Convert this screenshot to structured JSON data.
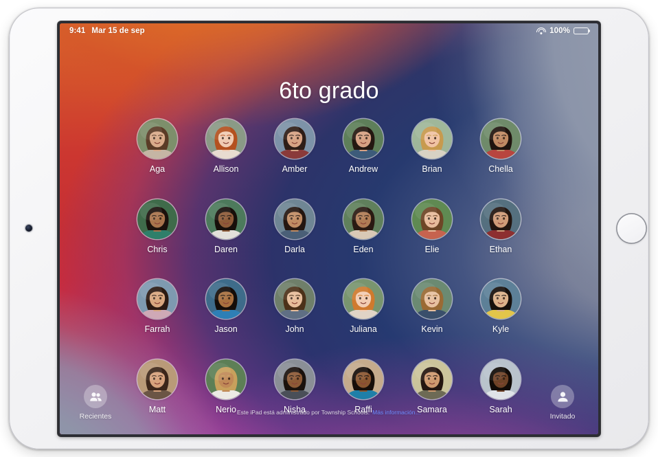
{
  "device": {
    "kind": "ipad",
    "camera_icon": "front-camera-dot",
    "home_button_icon": "home-button-ring"
  },
  "status_bar": {
    "time": "9:41",
    "date": "Mar 15 de sep",
    "wifi_icon": "wifi-icon",
    "battery_percent": "100%",
    "battery_icon": "battery-full-icon"
  },
  "header": {
    "title": "6to grado"
  },
  "users": [
    [
      {
        "name": "Aga",
        "skin": "#d9ab8a",
        "hair": "#5a3b26",
        "bg": "#7d8f6b",
        "shirt": "#c5b5a4"
      },
      {
        "name": "Allison",
        "skin": "#f0cbb2",
        "hair": "#b4511f",
        "bg": "#8a9a86",
        "shirt": "#e8dcd0"
      },
      {
        "name": "Amber",
        "skin": "#d7a384",
        "hair": "#2e1d16",
        "bg": "#7d93a8",
        "shirt": "#8a3a3a"
      },
      {
        "name": "Andrew",
        "skin": "#d6a183",
        "hair": "#241811",
        "bg": "#5e7f5a",
        "shirt": "#3d5b7a"
      },
      {
        "name": "Brian",
        "skin": "#f0c3a4",
        "hair": "#c79a4e",
        "bg": "#9fb79a",
        "shirt": "#d8d2c4"
      },
      {
        "name": "Chella",
        "skin": "#c08a63",
        "hair": "#20140f",
        "bg": "#6f8b6a",
        "shirt": "#b8453f"
      }
    ],
    [
      {
        "name": "Chris",
        "skin": "#a9744c",
        "hair": "#1b110c",
        "bg": "#3f6b4a",
        "shirt": "#2f7f6a"
      },
      {
        "name": "Daren",
        "skin": "#8e5b38",
        "hair": "#170f0a",
        "bg": "#4d7a5c",
        "shirt": "#e3e0da"
      },
      {
        "name": "Darla",
        "skin": "#c08c64",
        "hair": "#241610",
        "bg": "#6f8694",
        "shirt": "#4a5f77"
      },
      {
        "name": "Eden",
        "skin": "#b07c55",
        "hair": "#2a1a12",
        "bg": "#60805c",
        "shirt": "#d9c9b6"
      },
      {
        "name": "Elie",
        "skin": "#e8bb9c",
        "hair": "#6e4526",
        "bg": "#5f8a52",
        "shirt": "#c6634f"
      },
      {
        "name": "Ethan",
        "skin": "#cf9b78",
        "hair": "#221510",
        "bg": "#55707f",
        "shirt": "#8d2f30"
      }
    ],
    [
      {
        "name": "Farrah",
        "skin": "#d8a77f",
        "hair": "#2b1a12",
        "bg": "#7e9ab0",
        "shirt": "#cfa9b6"
      },
      {
        "name": "Jason",
        "skin": "#a8703f",
        "hair": "#140d09",
        "bg": "#3e6c8a",
        "shirt": "#2e7fb5"
      },
      {
        "name": "John",
        "skin": "#e6bd9b",
        "hair": "#4c3119",
        "bg": "#6f7f6a",
        "shirt": "#5f6f84"
      },
      {
        "name": "Juliana",
        "skin": "#f2cdb2",
        "hair": "#cf7a2e",
        "bg": "#79956f",
        "shirt": "#e0d4c6"
      },
      {
        "name": "Kevin",
        "skin": "#e8c1a0",
        "hair": "#9a6a34",
        "bg": "#6b8a72",
        "shirt": "#3a4f6b"
      },
      {
        "name": "Kyle",
        "skin": "#dcb18a",
        "hair": "#17100c",
        "bg": "#5d8098",
        "shirt": "#e3c54a"
      }
    ],
    [
      {
        "name": "Matt",
        "skin": "#d7a27c",
        "hair": "#3c261a",
        "bg": "#b99a78",
        "shirt": "#6b5545"
      },
      {
        "name": "Nerio",
        "skin": "#c08957",
        "hair": "#c8a05c",
        "bg": "#5d7f56",
        "shirt": "#eceae4"
      },
      {
        "name": "Nisha",
        "skin": "#8d5a36",
        "hair": "#1a110c",
        "bg": "#8a8f96",
        "shirt": "#4a4f58"
      },
      {
        "name": "Raffi",
        "skin": "#8a5630",
        "hair": "#160e09",
        "bg": "#c5ab8c",
        "shirt": "#1f7fa8"
      },
      {
        "name": "Samara",
        "skin": "#cf9a6f",
        "hair": "#241610",
        "bg": "#cbc49b",
        "shirt": "#6d6a55"
      },
      {
        "name": "Sarah",
        "skin": "#6e4226",
        "hair": "#110b07",
        "bg": "#b9c3cc",
        "shirt": "#dfe3e7"
      }
    ]
  ],
  "footer": {
    "managed_text": "Este iPad está administrado por Township Schools.",
    "managed_link": "Más información…",
    "link_color": "#6e8cff"
  },
  "recents_button": {
    "label": "Recientes",
    "icon": "two-people-icon"
  },
  "guest_button": {
    "label": "Invitado",
    "icon": "person-icon"
  }
}
